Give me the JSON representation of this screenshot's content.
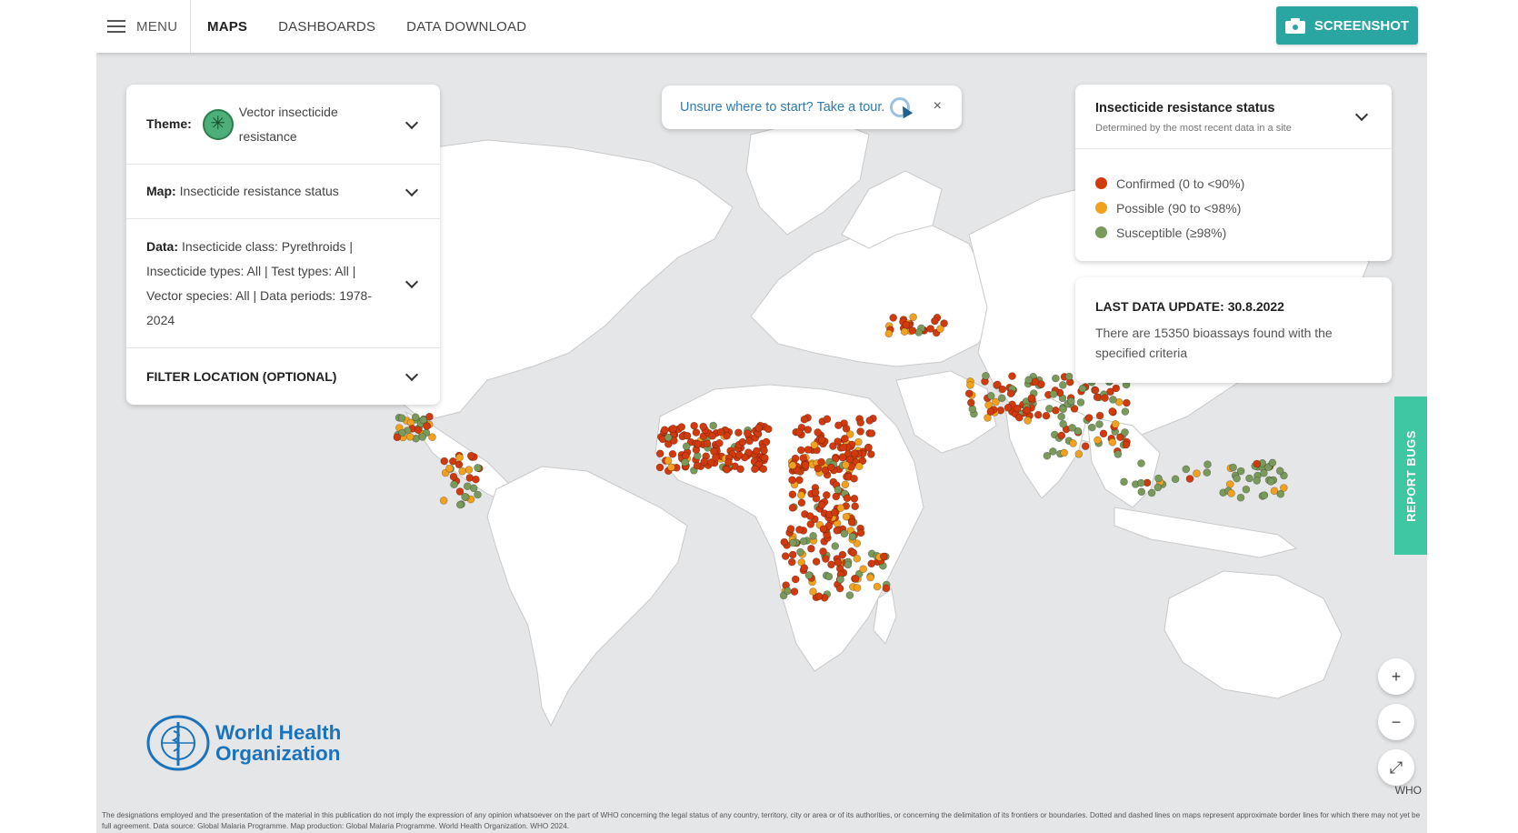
{
  "header": {
    "menu_label": "MENU",
    "nav": [
      "MAPS",
      "DASHBOARDS",
      "DATA DOWNLOAD"
    ],
    "active_nav": "MAPS",
    "screenshot_label": "SCREENSHOT"
  },
  "panel": {
    "theme_label": "Theme:",
    "theme_value": "Vector insecticide resistance",
    "map_label": "Map:",
    "map_value": "Insecticide resistance status",
    "data_label": "Data:",
    "data_value": "Insecticide class: Pyrethroids | Insecticide types: All | Test types: All | Vector species: All | Data periods: 1978-2024",
    "filter_label": "FILTER LOCATION (OPTIONAL)"
  },
  "tour": {
    "text": "Unsure where to start? Take a tour.",
    "close": "×"
  },
  "legend": {
    "title": "Insecticide resistance status",
    "subtitle": "Determined by the most recent data in a site",
    "items": [
      {
        "label": "Confirmed (0 to <90%)",
        "color": "#d13a0c"
      },
      {
        "label": "Possible (90 to <98%)",
        "color": "#f1a11d"
      },
      {
        "label": "Susceptible (≥98%)",
        "color": "#7a9a5c"
      }
    ]
  },
  "update": {
    "title": "LAST DATA UPDATE: 30.8.2022",
    "text": "There are 15350 bioassays found with the specified criteria"
  },
  "report_label": "REPORT BUGS",
  "controls": {
    "zoom_in": "+",
    "zoom_out": "−",
    "fullscreen": "⤢"
  },
  "attribution": "WHO",
  "logo": {
    "line1": "World Health",
    "line2": "Organization"
  },
  "disclaimer": "The designations employed and the presentation of the material in this publication do not imply the expression of any opinion whatsoever on the part of WHO concerning the legal status of any country, territory, city or area or of its authorities, or concerning the delimitation of its frontiers or boundaries. Dotted and dashed lines on maps represent approximate border lines for which there may not yet be full agreement. Data source: Global Malaria Programme. Map production: Global Malaria Programme. World Health Organization. WHO 2024."
}
